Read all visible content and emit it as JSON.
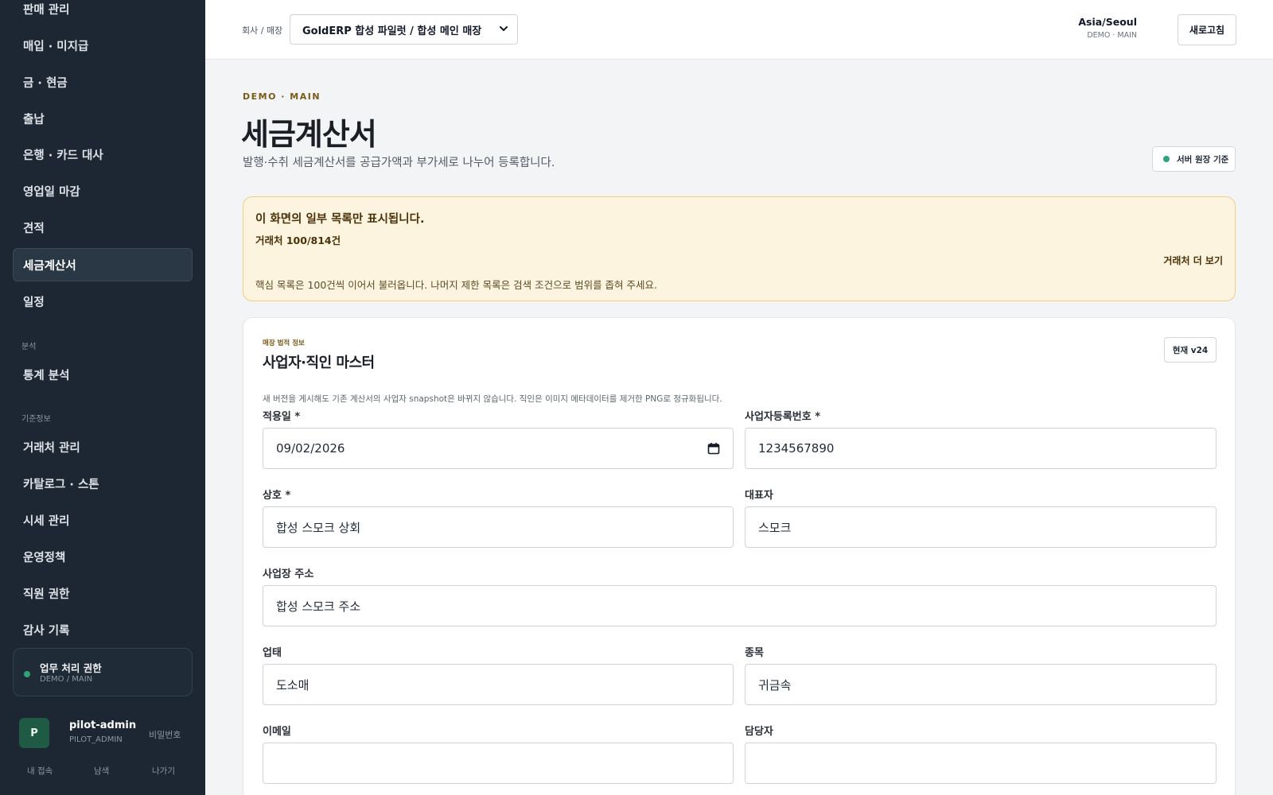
{
  "sidebar": {
    "items": [
      {
        "label": "판매 관리"
      },
      {
        "label": "매입 · 미지급"
      },
      {
        "label": "금 · 현금"
      },
      {
        "label": "출납"
      },
      {
        "label": "은행 · 카드 대사"
      },
      {
        "label": "영업일 마감"
      },
      {
        "label": "견적"
      },
      {
        "label": "세금계산서",
        "active": true
      },
      {
        "label": "일정"
      }
    ],
    "section_analysis": "분석",
    "analysis_items": [
      {
        "label": "통계 분석"
      }
    ],
    "section_master": "기준정보",
    "master_items": [
      {
        "label": "거래처 관리"
      },
      {
        "label": "카탈로그 · 스톤"
      },
      {
        "label": "시세 관리"
      },
      {
        "label": "운영정책"
      },
      {
        "label": "직원 권한"
      },
      {
        "label": "감사 기록"
      }
    ],
    "permission": {
      "title": "업무 처리 권한",
      "scope": "DEMO / MAIN",
      "status_color": "#2fa37a"
    },
    "user": {
      "avatar_letter": "P",
      "name": "pilot-admin",
      "role": "PILOT_ADMIN",
      "password_link": "비밀번호",
      "links": [
        "내 접속",
        "남색",
        "나가기"
      ]
    }
  },
  "topbar": {
    "company_label": "회사 / 매장",
    "company_select": "GoldERP 합성 파일럿 / 합성 메인 매장",
    "timezone": "Asia/Seoul",
    "scope": "DEMO · MAIN",
    "refresh_label": "새로고침"
  },
  "header": {
    "eyebrow": "DEMO · MAIN",
    "title": "세금계산서",
    "description": "발행·수취 세금계산서를 공급가액과 부가세로 나누어 등록합니다.",
    "server_chip": "서버 원장 기준"
  },
  "warning": {
    "title": "이 화면의 일부 목록만 표시됩니다.",
    "count": "거래처 100/814건",
    "more_link": "거래처 더 보기",
    "note": "핵심 목록은 100건씩 이어서 불러옵니다. 나머지 제한 목록은 검색 조건으로 범위를 좁혀 주세요."
  },
  "card": {
    "eyebrow": "매장 법적 정보",
    "title": "사업자·직인 마스터",
    "version": "현재 v24",
    "note": "새 버전을 게시해도 기존 계산서의 사업자 snapshot은 바뀌지 않습니다. 직인은 이미지 메타데이터를 제거한 PNG로 정규화됩니다.",
    "fields": {
      "effective_date": {
        "label": "적용일 *",
        "value": "09/02/2026"
      },
      "biz_number": {
        "label": "사업자등록번호 *",
        "value": "1234567890"
      },
      "company_name": {
        "label": "상호 *",
        "value": "합성 스모크 상회"
      },
      "representative": {
        "label": "대표자",
        "value": "스모크"
      },
      "address": {
        "label": "사업장 주소",
        "value": "합성 스모크 주소"
      },
      "business_type": {
        "label": "업태",
        "value": "도소매"
      },
      "business_item": {
        "label": "종목",
        "value": "귀금속"
      },
      "email": {
        "label": "이메일",
        "value": ""
      },
      "contact": {
        "label": "담당자",
        "value": ""
      }
    }
  },
  "colors": {
    "sidebar_bg": "#1c2733",
    "accent_gold": "#7a5a16",
    "warning_bg": "#fdf4e0",
    "warning_border": "#efcf86",
    "status_green": "#2fa37a"
  }
}
